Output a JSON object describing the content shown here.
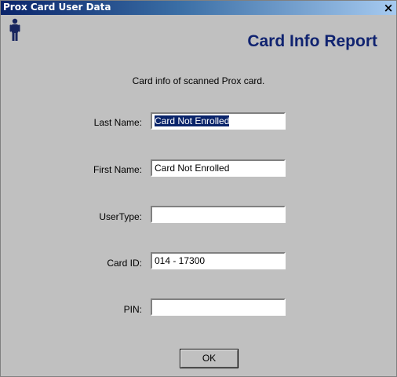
{
  "window": {
    "title": "Prox Card User Data",
    "close_glyph": "×"
  },
  "header": {
    "icon": "person-icon",
    "title": "Card Info Report",
    "subtitle": "Card info of scanned Prox card."
  },
  "fields": [
    {
      "label": "Last Name:",
      "value": "Card Not Enrolled",
      "selected": true
    },
    {
      "label": "First Name:",
      "value": "Card Not Enrolled",
      "selected": false
    },
    {
      "label": "UserType:",
      "value": "",
      "selected": false
    },
    {
      "label": "Card ID:",
      "value": "014 - 17300",
      "selected": false
    },
    {
      "label": "PIN:",
      "value": "",
      "selected": false
    }
  ],
  "buttons": {
    "ok_label": "OK"
  },
  "colors": {
    "title_bar": "#0a246a",
    "report_title": "#102370",
    "window_bg": "#c0c0c0",
    "selection": "#0a246a"
  }
}
